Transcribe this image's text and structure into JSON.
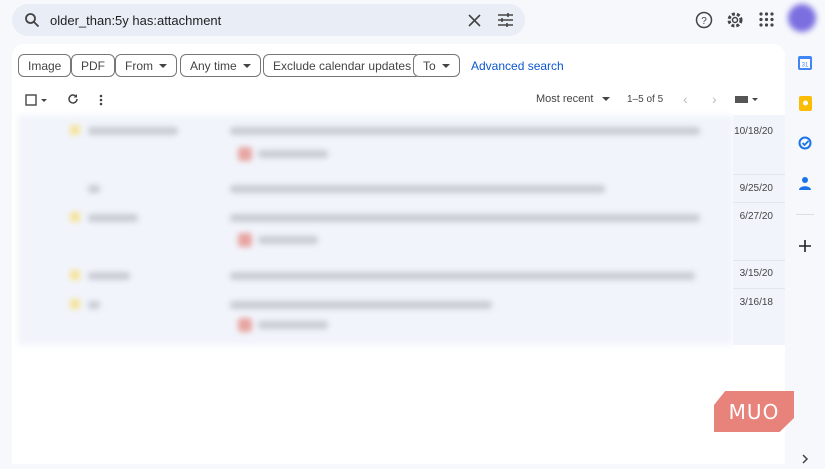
{
  "search": {
    "query": "older_than:5y has:attachment"
  },
  "filters": {
    "chips": [
      {
        "label": "Image"
      },
      {
        "label": "PDF"
      },
      {
        "label": "From"
      },
      {
        "label": "Any time"
      },
      {
        "label": "Exclude calendar updates"
      },
      {
        "label": "To"
      }
    ],
    "advanced": "Advanced search"
  },
  "toolbar": {
    "sort": "Most recent",
    "pagination": "1–5 of 5"
  },
  "emails": [
    {
      "date": "10/18/20"
    },
    {
      "date": "9/25/20"
    },
    {
      "date": "6/27/20"
    },
    {
      "date": "3/15/20"
    },
    {
      "date": "3/16/18"
    }
  ],
  "watermark": "MUO"
}
